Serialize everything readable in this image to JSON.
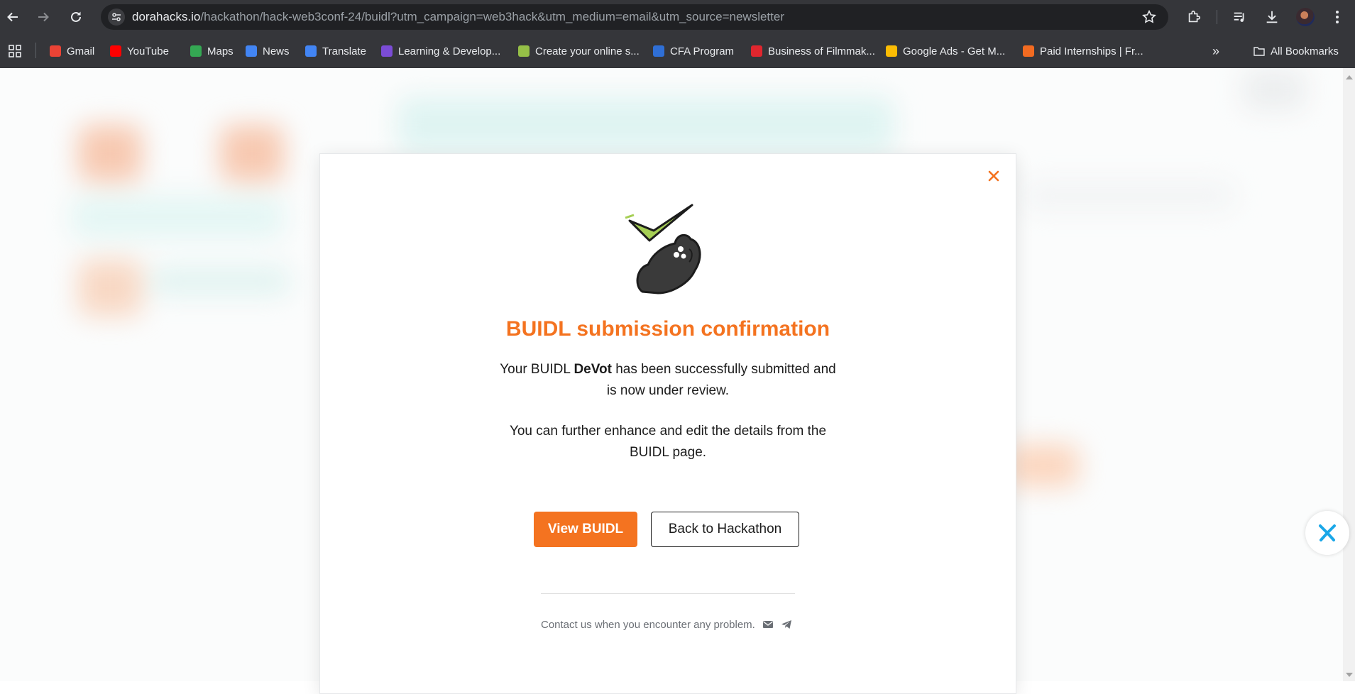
{
  "browser": {
    "url_host": "dorahacks.io",
    "url_path": "/hackathon/hack-web3conf-24/buidl?utm_campaign=web3hack&utm_medium=email&utm_source=newsletter",
    "bookmarks": [
      {
        "label": "Gmail",
        "icon": "gmail-icon",
        "color": "#ea4335"
      },
      {
        "label": "YouTube",
        "icon": "youtube-icon",
        "color": "#ff0000"
      },
      {
        "label": "Maps",
        "icon": "maps-icon",
        "color": "#34a853"
      },
      {
        "label": "News",
        "icon": "news-icon",
        "color": "#4285f4"
      },
      {
        "label": "Translate",
        "icon": "translate-icon",
        "color": "#4285f4"
      },
      {
        "label": "Learning & Develop...",
        "icon": "learning-icon",
        "color": "#7b4cd6"
      },
      {
        "label": "Create your online s...",
        "icon": "shopify-icon",
        "color": "#95bf47"
      },
      {
        "label": "CFA Program",
        "icon": "cfa-icon",
        "color": "#2f6fd6"
      },
      {
        "label": "Business of Filmmak...",
        "icon": "filmmaking-icon",
        "color": "#e0262e"
      },
      {
        "label": "Google Ads - Get M...",
        "icon": "google-ads-icon",
        "color": "#fbbc04"
      },
      {
        "label": "Paid Internships | Fr...",
        "icon": "internships-icon",
        "color": "#f26b21"
      }
    ],
    "all_bookmarks_label": "All Bookmarks"
  },
  "modal": {
    "title": "BUIDL submission confirmation",
    "message_prefix": "Your BUIDL ",
    "buidl_name": "DeVot",
    "message_suffix": " has been successfully submitted and is now under review.",
    "message_2": "You can further enhance and edit the details from the BUIDL page.",
    "primary_button": "View BUIDL",
    "secondary_button": "Back to Hackathon",
    "contact_text": "Contact us when you encounter any problem."
  },
  "colors": {
    "accent": "#f47320",
    "chrome_bg": "#35363a",
    "omnibox_bg": "#202124"
  }
}
